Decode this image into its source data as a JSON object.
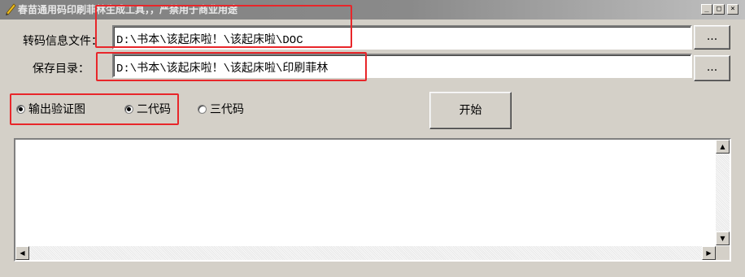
{
  "window": {
    "title": "春苗通用码印刷菲林生成工具，，严禁用于商业用途",
    "min_label": "_",
    "max_label": "□",
    "close_label": "×"
  },
  "form": {
    "source_label": "转码信息文件：",
    "source_value": "D:\\书本\\该起床啦！\\该起床啦\\DOC",
    "source_browse": "...",
    "save_label": "保存目录：",
    "save_value": "D:\\书本\\该起床啦！\\该起床啦\\印刷菲林",
    "save_browse": "..."
  },
  "options": {
    "verify_image": "输出验证图",
    "verify_checked": true,
    "code2": "二代码",
    "code2_checked": true,
    "code3": "三代码",
    "code3_checked": false
  },
  "actions": {
    "start": "开始"
  },
  "scroll": {
    "up": "▲",
    "down": "▼",
    "left": "◀",
    "right": "▶"
  },
  "annotation_color": "#e8262a"
}
